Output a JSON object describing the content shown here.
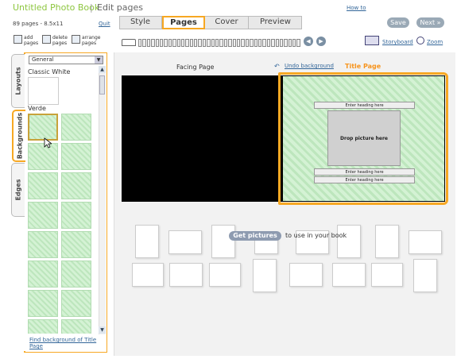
{
  "app": {
    "title": "Untitled Photo Book",
    "separator": "|",
    "mode": "Edit pages",
    "how_to": "How to"
  },
  "info": {
    "pages_info": "89 pages - 8.5x11",
    "quit": "Quit"
  },
  "tabs": [
    {
      "label": "Style",
      "active": false
    },
    {
      "label": "Pages",
      "active": true
    },
    {
      "label": "Cover",
      "active": false
    },
    {
      "label": "Preview",
      "active": false
    }
  ],
  "buttons": {
    "save": "Save",
    "next": "Next »"
  },
  "toolbar": {
    "add": "add pages",
    "delete": "delete pages",
    "arrange": "arrange pages",
    "storyboard": "Storyboard",
    "zoom": "Zoom"
  },
  "side_tabs": [
    "Layouts",
    "Backgrounds",
    "Edges"
  ],
  "panel": {
    "dropdown_value": "General",
    "section1": "Classic White",
    "section2": "Verde",
    "find_link": "Find background of Title Page"
  },
  "editor": {
    "facing_page": "Facing Page",
    "undo_background": "Undo background",
    "title_page": "Title Page",
    "heading_top": "Enter heading here",
    "drop_picture": "Drop picture here",
    "heading_bottom1": "Enter heading here",
    "heading_bottom2": "Enter heading here"
  },
  "get_pictures": {
    "button": "Get pictures",
    "text": "to use in your book"
  },
  "colors": {
    "accent": "#f7a823",
    "brand": "#8dc63f",
    "link": "#336699",
    "swatch": "#c8ecc8"
  }
}
